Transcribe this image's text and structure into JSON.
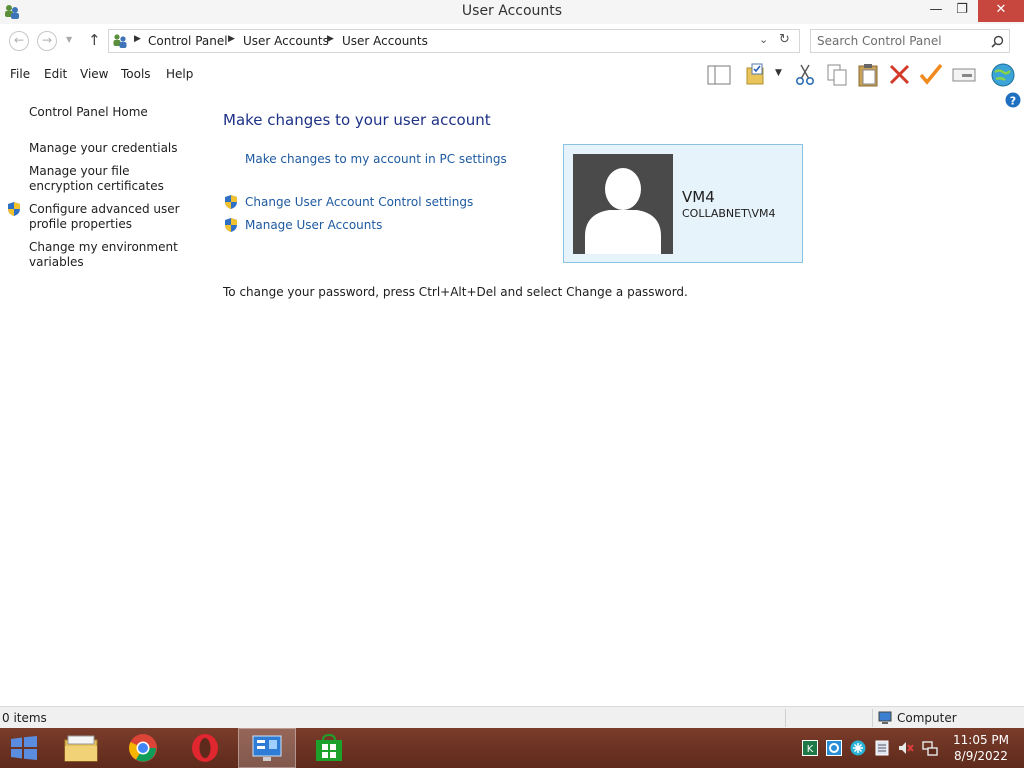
{
  "window": {
    "title": "User Accounts",
    "controls": {
      "minimize": "—",
      "restore": "❐",
      "close": "✕"
    }
  },
  "address_bar": {
    "breadcrumbs": [
      "Control Panel",
      "User Accounts",
      "User Accounts"
    ],
    "search_placeholder": "Search Control Panel"
  },
  "menu": {
    "items": [
      "File",
      "Edit",
      "View",
      "Tools",
      "Help"
    ]
  },
  "toolbar": {
    "icons": [
      "preview-pane-icon",
      "folder-options-icon",
      "cut-icon",
      "copy-icon",
      "paste-icon",
      "delete-icon",
      "checkmark-icon",
      "properties-icon",
      "globe-icon",
      "help-icon"
    ]
  },
  "sidebar": {
    "items": [
      {
        "label": "Control Panel Home"
      },
      {
        "label": "Manage your credentials"
      },
      {
        "label": "Manage your file encryption certificates"
      },
      {
        "label": "Configure advanced user profile properties"
      },
      {
        "label": "Change my environment variables"
      }
    ]
  },
  "main": {
    "title": "Make changes to your user account",
    "links": {
      "pc_settings": "Make changes to my account in PC settings",
      "uac": "Change User Account Control settings",
      "manage": "Manage User Accounts"
    },
    "password_note": "To change your password, press Ctrl+Alt+Del and select Change a password."
  },
  "account": {
    "name": "VM4",
    "domain": "COLLABNET\\VM4"
  },
  "status_bar": {
    "items_count": "0 items",
    "location": "Computer"
  },
  "taskbar": {
    "time": "11:05 PM",
    "date": "8/9/2022"
  },
  "colors": {
    "link": "#1e5aa0",
    "heading": "#1e3287",
    "card_bg": "#e6f3fa",
    "card_border": "#89c3e3",
    "taskbar": "#6b3222",
    "close_button": "#c7463e"
  }
}
